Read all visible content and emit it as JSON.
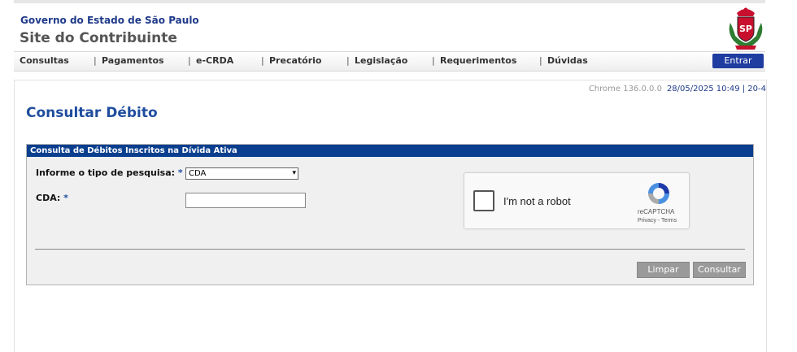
{
  "header": {
    "gov_title": "Governo do Estado de São Paulo",
    "site_title": "Site do Contribuinte",
    "crest_icon": "sp-coat-of-arms-icon",
    "crest_text": "SP"
  },
  "nav": {
    "items": [
      "Consultas",
      "Pagamentos",
      "e-CRDA",
      "Precatório",
      "Legislação",
      "Requerimentos",
      "Dúvidas"
    ],
    "separator": "|",
    "login_label": "Entrar"
  },
  "status": {
    "browser": "Chrome 136.0.0.0",
    "datetime": "28/05/2025 10:49 | 20-4"
  },
  "page": {
    "title": "Consultar Débito"
  },
  "panel": {
    "header": "Consulta de Débitos Inscritos na Dívida Ativa",
    "search_type_label": "Informe o tipo de pesquisa:",
    "search_type_value": "CDA",
    "cda_label": "CDA:",
    "cda_value": "",
    "required_mark": "*"
  },
  "captcha": {
    "label": "I'm not a robot",
    "brand": "reCAPTCHA",
    "terms": "Privacy - Terms",
    "icon": "recaptcha-icon"
  },
  "buttons": {
    "clear": "Limpar",
    "submit": "Consultar"
  },
  "colors": {
    "brand_blue": "#1f3da0",
    "panel_header": "#0a3f8f",
    "title_blue": "#1f4d9e"
  }
}
